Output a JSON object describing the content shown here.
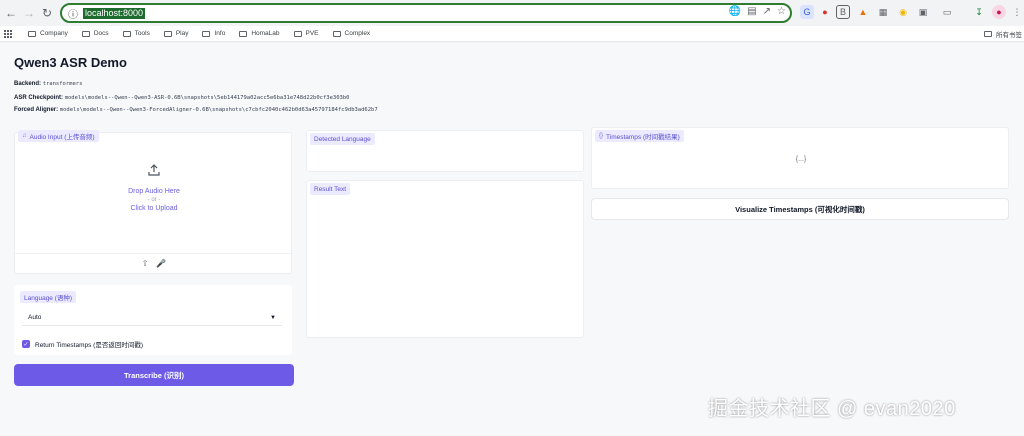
{
  "browser": {
    "url": "localhost:8000",
    "bookmarks": [
      "Company",
      "Docs",
      "Tools",
      "Play",
      "Info",
      "HomaLab",
      "PVE",
      "Complex"
    ],
    "all_bookmarks": "所有书签"
  },
  "app": {
    "title": "Qwen3 ASR Demo",
    "backend_label": "Backend:",
    "backend_value": "transformers",
    "asr_label": "ASR Checkpoint:",
    "asr_value": "models\\models--Qwen--Qwen3-ASR-0.6B\\snapshots\\5eb144179a02acc5e6ba31e748d22b0cf3e303b0",
    "aligner_label": "Forced Aligner:",
    "aligner_value": "models\\models--Qwen--Qwen3-ForcedAligner-0.6B\\snapshots\\c7cbfc2040c462b0d63a45797184fc9db3ad62b7"
  },
  "audio": {
    "label": "Audio Input (上传音频)",
    "drop_text": "Drop Audio Here",
    "or_text": "- or -",
    "click_text": "Click to Upload"
  },
  "language": {
    "label": "Language (语种)",
    "selected": "Auto"
  },
  "timestamps_check": {
    "label": "Return Timestamps (是否返回时间戳)",
    "checked": true
  },
  "buttons": {
    "transcribe": "Transcribe (识别)",
    "visualize": "Visualize Timestamps (可视化时间戳)"
  },
  "outputs": {
    "detected_label": "Detected Language",
    "result_label": "Result Text",
    "timestamps_label": "Timestamps (时间戳结果)",
    "timestamps_empty": "{...}"
  },
  "watermark": "掘金技术社区 @ evan2020",
  "colors": {
    "accent": "#6d5be7",
    "chip_bg": "#ebeaff",
    "url_outline": "#2e7d32"
  }
}
